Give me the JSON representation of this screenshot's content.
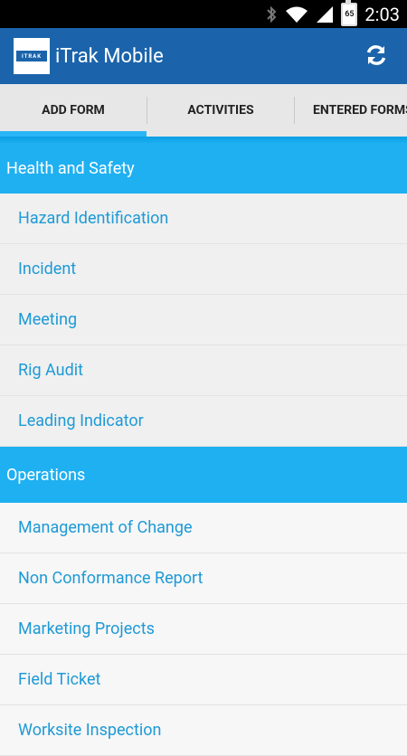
{
  "status_bar": {
    "time": "2:03",
    "battery_level": "65",
    "icons": [
      "bluetooth-icon",
      "wifi-icon",
      "signal-icon",
      "battery-icon"
    ]
  },
  "app_bar": {
    "logo_text": "ITRAK",
    "title": "iTrak Mobile",
    "refresh_icon": "refresh-icon"
  },
  "tabs": [
    {
      "label": "ADD FORM",
      "active": true
    },
    {
      "label": "ACTIVITIES",
      "active": false
    },
    {
      "label": "ENTERED FORMS",
      "active": false
    }
  ],
  "sections": [
    {
      "title": "Health and Safety",
      "items": [
        "Hazard Identification",
        "Incident",
        "Meeting",
        "Rig Audit",
        "Leading Indicator"
      ]
    },
    {
      "title": "Operations",
      "items": [
        "Management of Change",
        "Non Conformance Report",
        "Marketing Projects",
        "Field Ticket",
        "Worksite Inspection"
      ]
    }
  ],
  "colors": {
    "app_bar": "#1b64ab",
    "section_header": "#1fb0f1",
    "item_text": "#1e9ad6",
    "tab_indicator": "#29b6f6"
  }
}
